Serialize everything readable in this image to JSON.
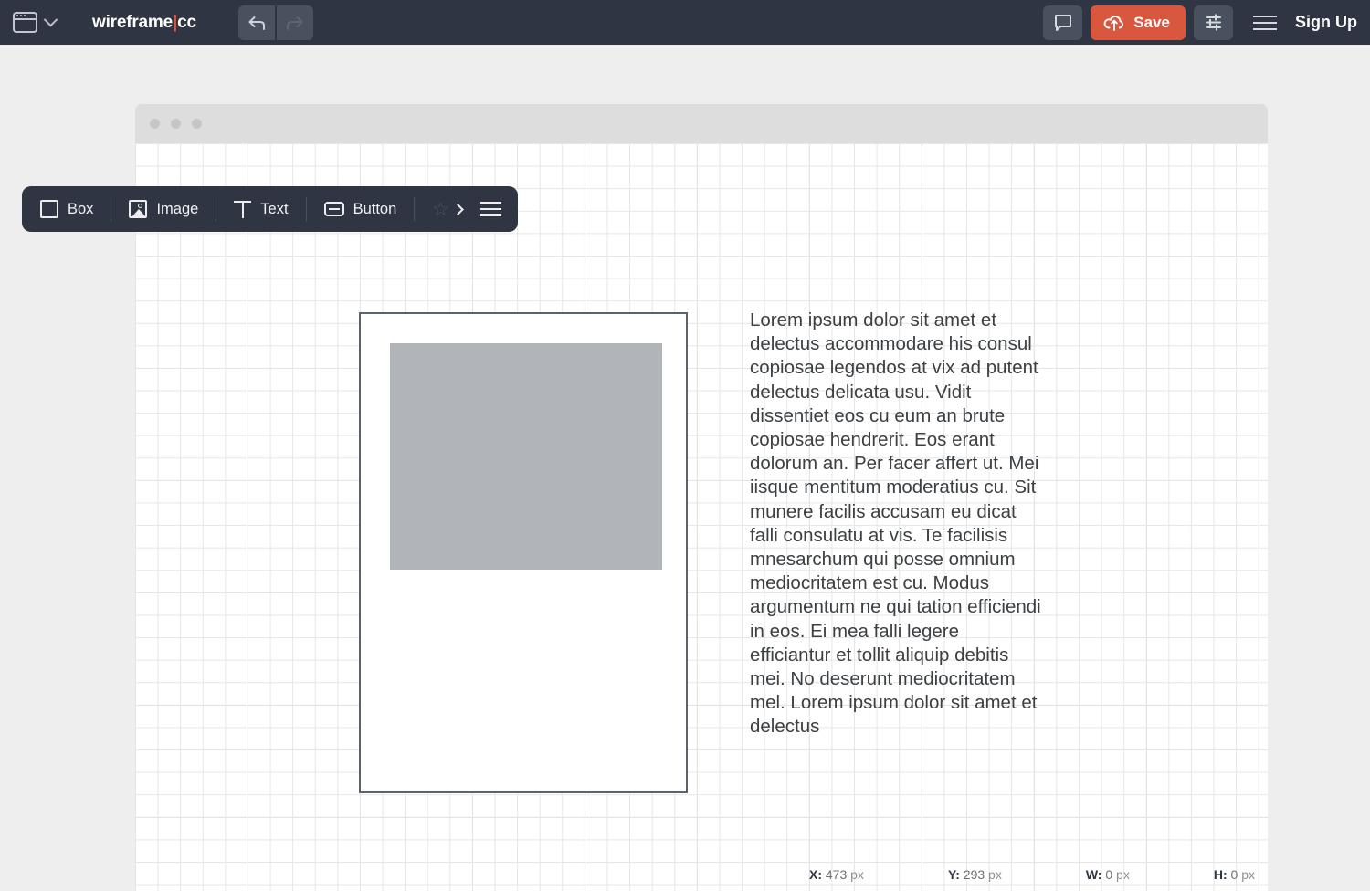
{
  "topbar": {
    "window_icon": "browser-window-icon",
    "dropdown_icon": "chevron-down-icon",
    "brand_prefix": "wireframe",
    "brand_caret": "|",
    "brand_suffix": "cc",
    "undo_icon": "undo-arrow-icon",
    "redo_icon": "redo-arrow-icon",
    "comment_icon": "comment-bubble-icon",
    "save_label": "Save",
    "save_icon": "cloud-upload-icon",
    "settings_icon": "sliders-icon",
    "menu_icon": "hamburger-menu-icon",
    "signup_label": "Sign Up",
    "accent_color": "#d9573f",
    "bar_color": "#2f3542"
  },
  "toolbar": {
    "tools": [
      {
        "label": "Box",
        "icon": "square-icon"
      },
      {
        "label": "Image",
        "icon": "image-icon"
      },
      {
        "label": "Text",
        "icon": "text-t-icon"
      },
      {
        "label": "Button",
        "icon": "button-icon"
      }
    ],
    "star_icon": "star-icon",
    "chevron_icon": "chevron-right-icon",
    "menu_icon": "hamburger-menu-icon"
  },
  "mock_window": {
    "dots": [
      "dot-1",
      "dot-2",
      "dot-3"
    ]
  },
  "canvas": {
    "card": {
      "image_placeholder": "image-placeholder"
    },
    "text_block": "Lorem ipsum dolor sit amet et delectus accommodare his consul copiosae legendos at vix ad putent delectus delicata usu. Vidit dissentiet eos cu eum an brute copiosae hendrerit. Eos erant dolorum an. Per facer affert ut. Mei iisque mentitum moderatius cu. Sit munere facilis accusam eu dicat falli consulatu at vis. Te facilisis mnesarchum qui posse omnium mediocritatem est cu. Modus argumentum ne qui tation efficiendi in eos. Ei mea falli legere efficiantur et tollit aliquip debitis mei. No deserunt mediocritatem mel. Lorem ipsum dolor sit amet et delectus"
  },
  "status": {
    "x_label": "X:",
    "x_value": "473",
    "y_label": "Y:",
    "y_value": "293",
    "w_label": "W:",
    "w_value": "0",
    "h_label": "H:",
    "h_value": "0",
    "unit": "px"
  }
}
